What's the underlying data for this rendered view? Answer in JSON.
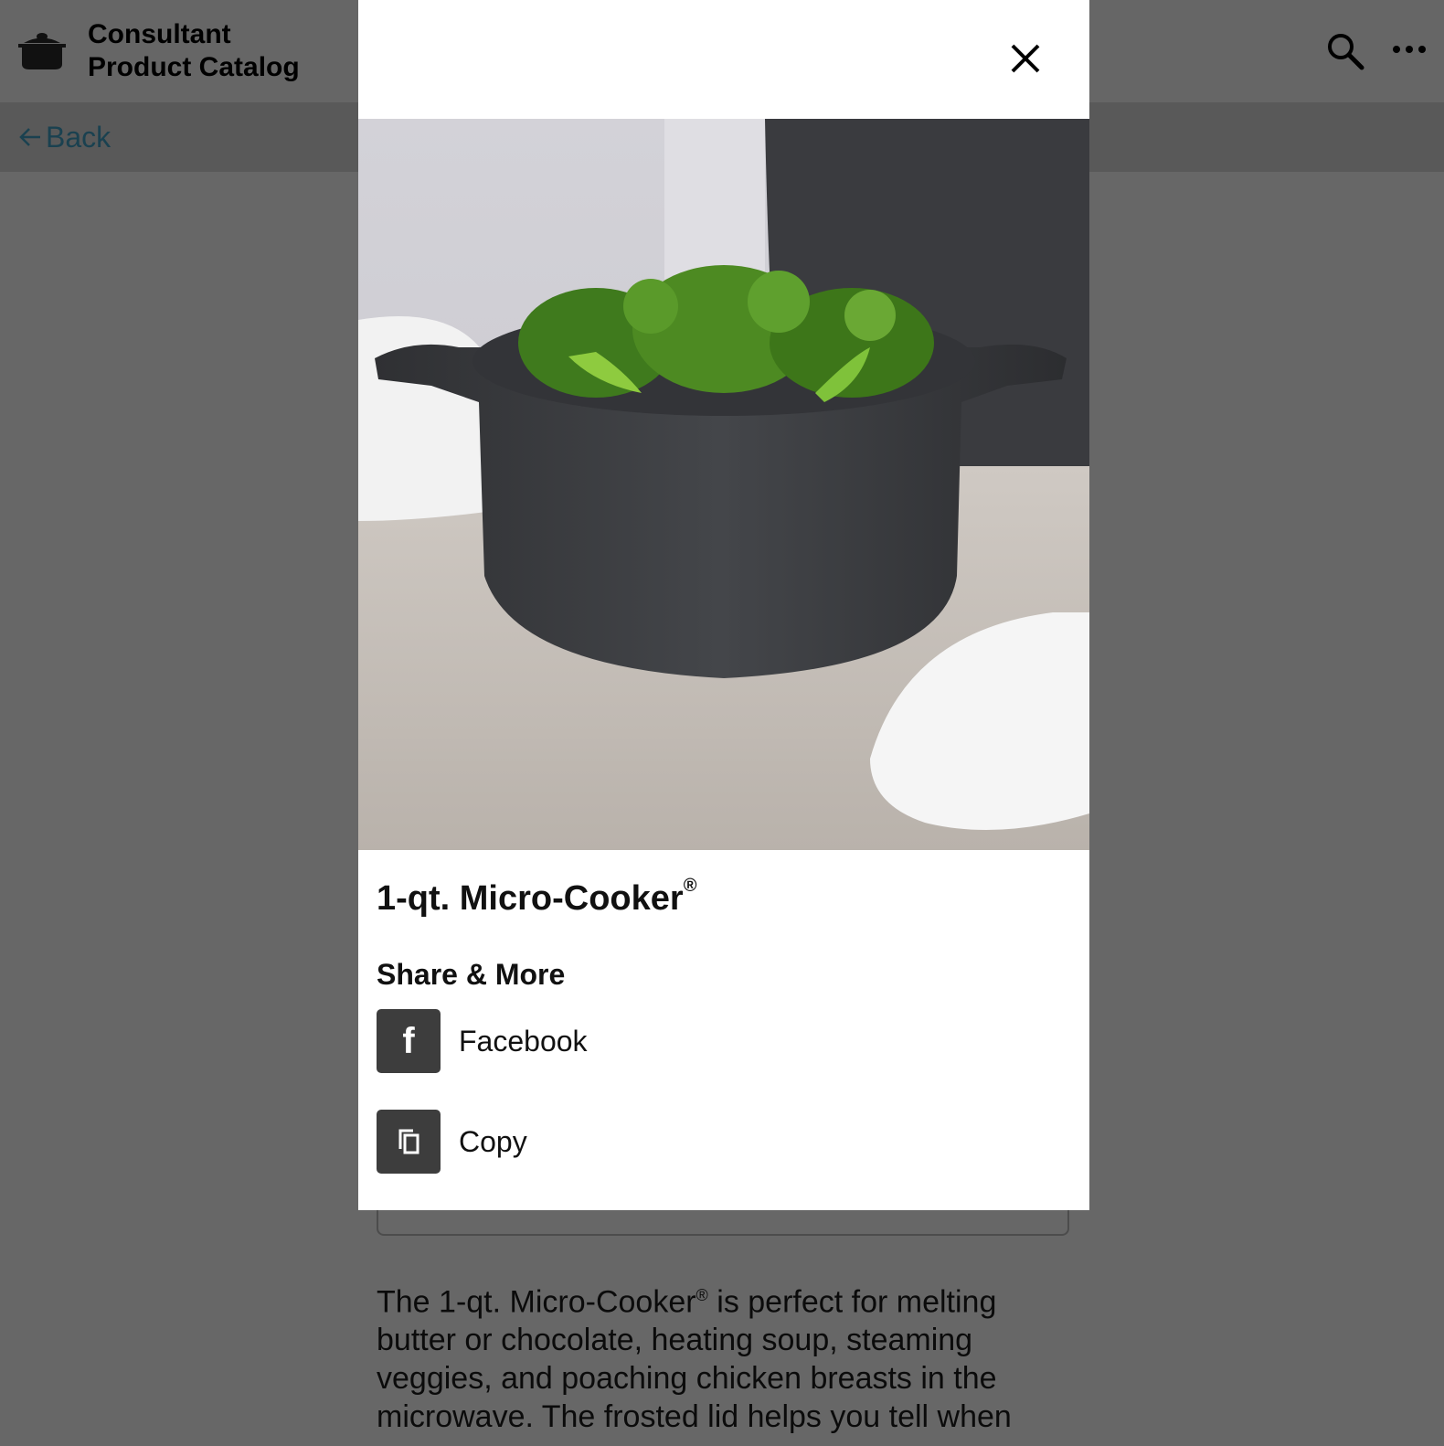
{
  "header": {
    "title_line1": "Consultant",
    "title_line2": "Product Catalog",
    "logo_icon": "cooking-pot-icon",
    "search_icon": "search-icon",
    "more_icon": "more-horizontal-icon"
  },
  "subheader": {
    "back_label": "Back"
  },
  "modal": {
    "close_icon": "close-icon",
    "product_name": "1-qt. Micro-Cooker",
    "registered_mark": "®",
    "share_heading": "Share & More",
    "share_options": [
      {
        "label": "Facebook",
        "icon": "facebook-icon"
      },
      {
        "label": "Copy",
        "icon": "copy-icon"
      }
    ]
  },
  "background": {
    "description_part1": "The 1-qt. Micro-Cooker",
    "description_mark": "®",
    "description_part2": " is perfect for melting butter or chocolate, heating soup, steaming veggies, and poaching chicken breasts in the microwave. The frosted lid helps you tell when"
  },
  "colors": {
    "overlay": "#676767",
    "header_bg": "#666666",
    "subheader_bg": "#595959",
    "back_link": "#1a4150",
    "tile_bg": "#3d3d3d"
  }
}
